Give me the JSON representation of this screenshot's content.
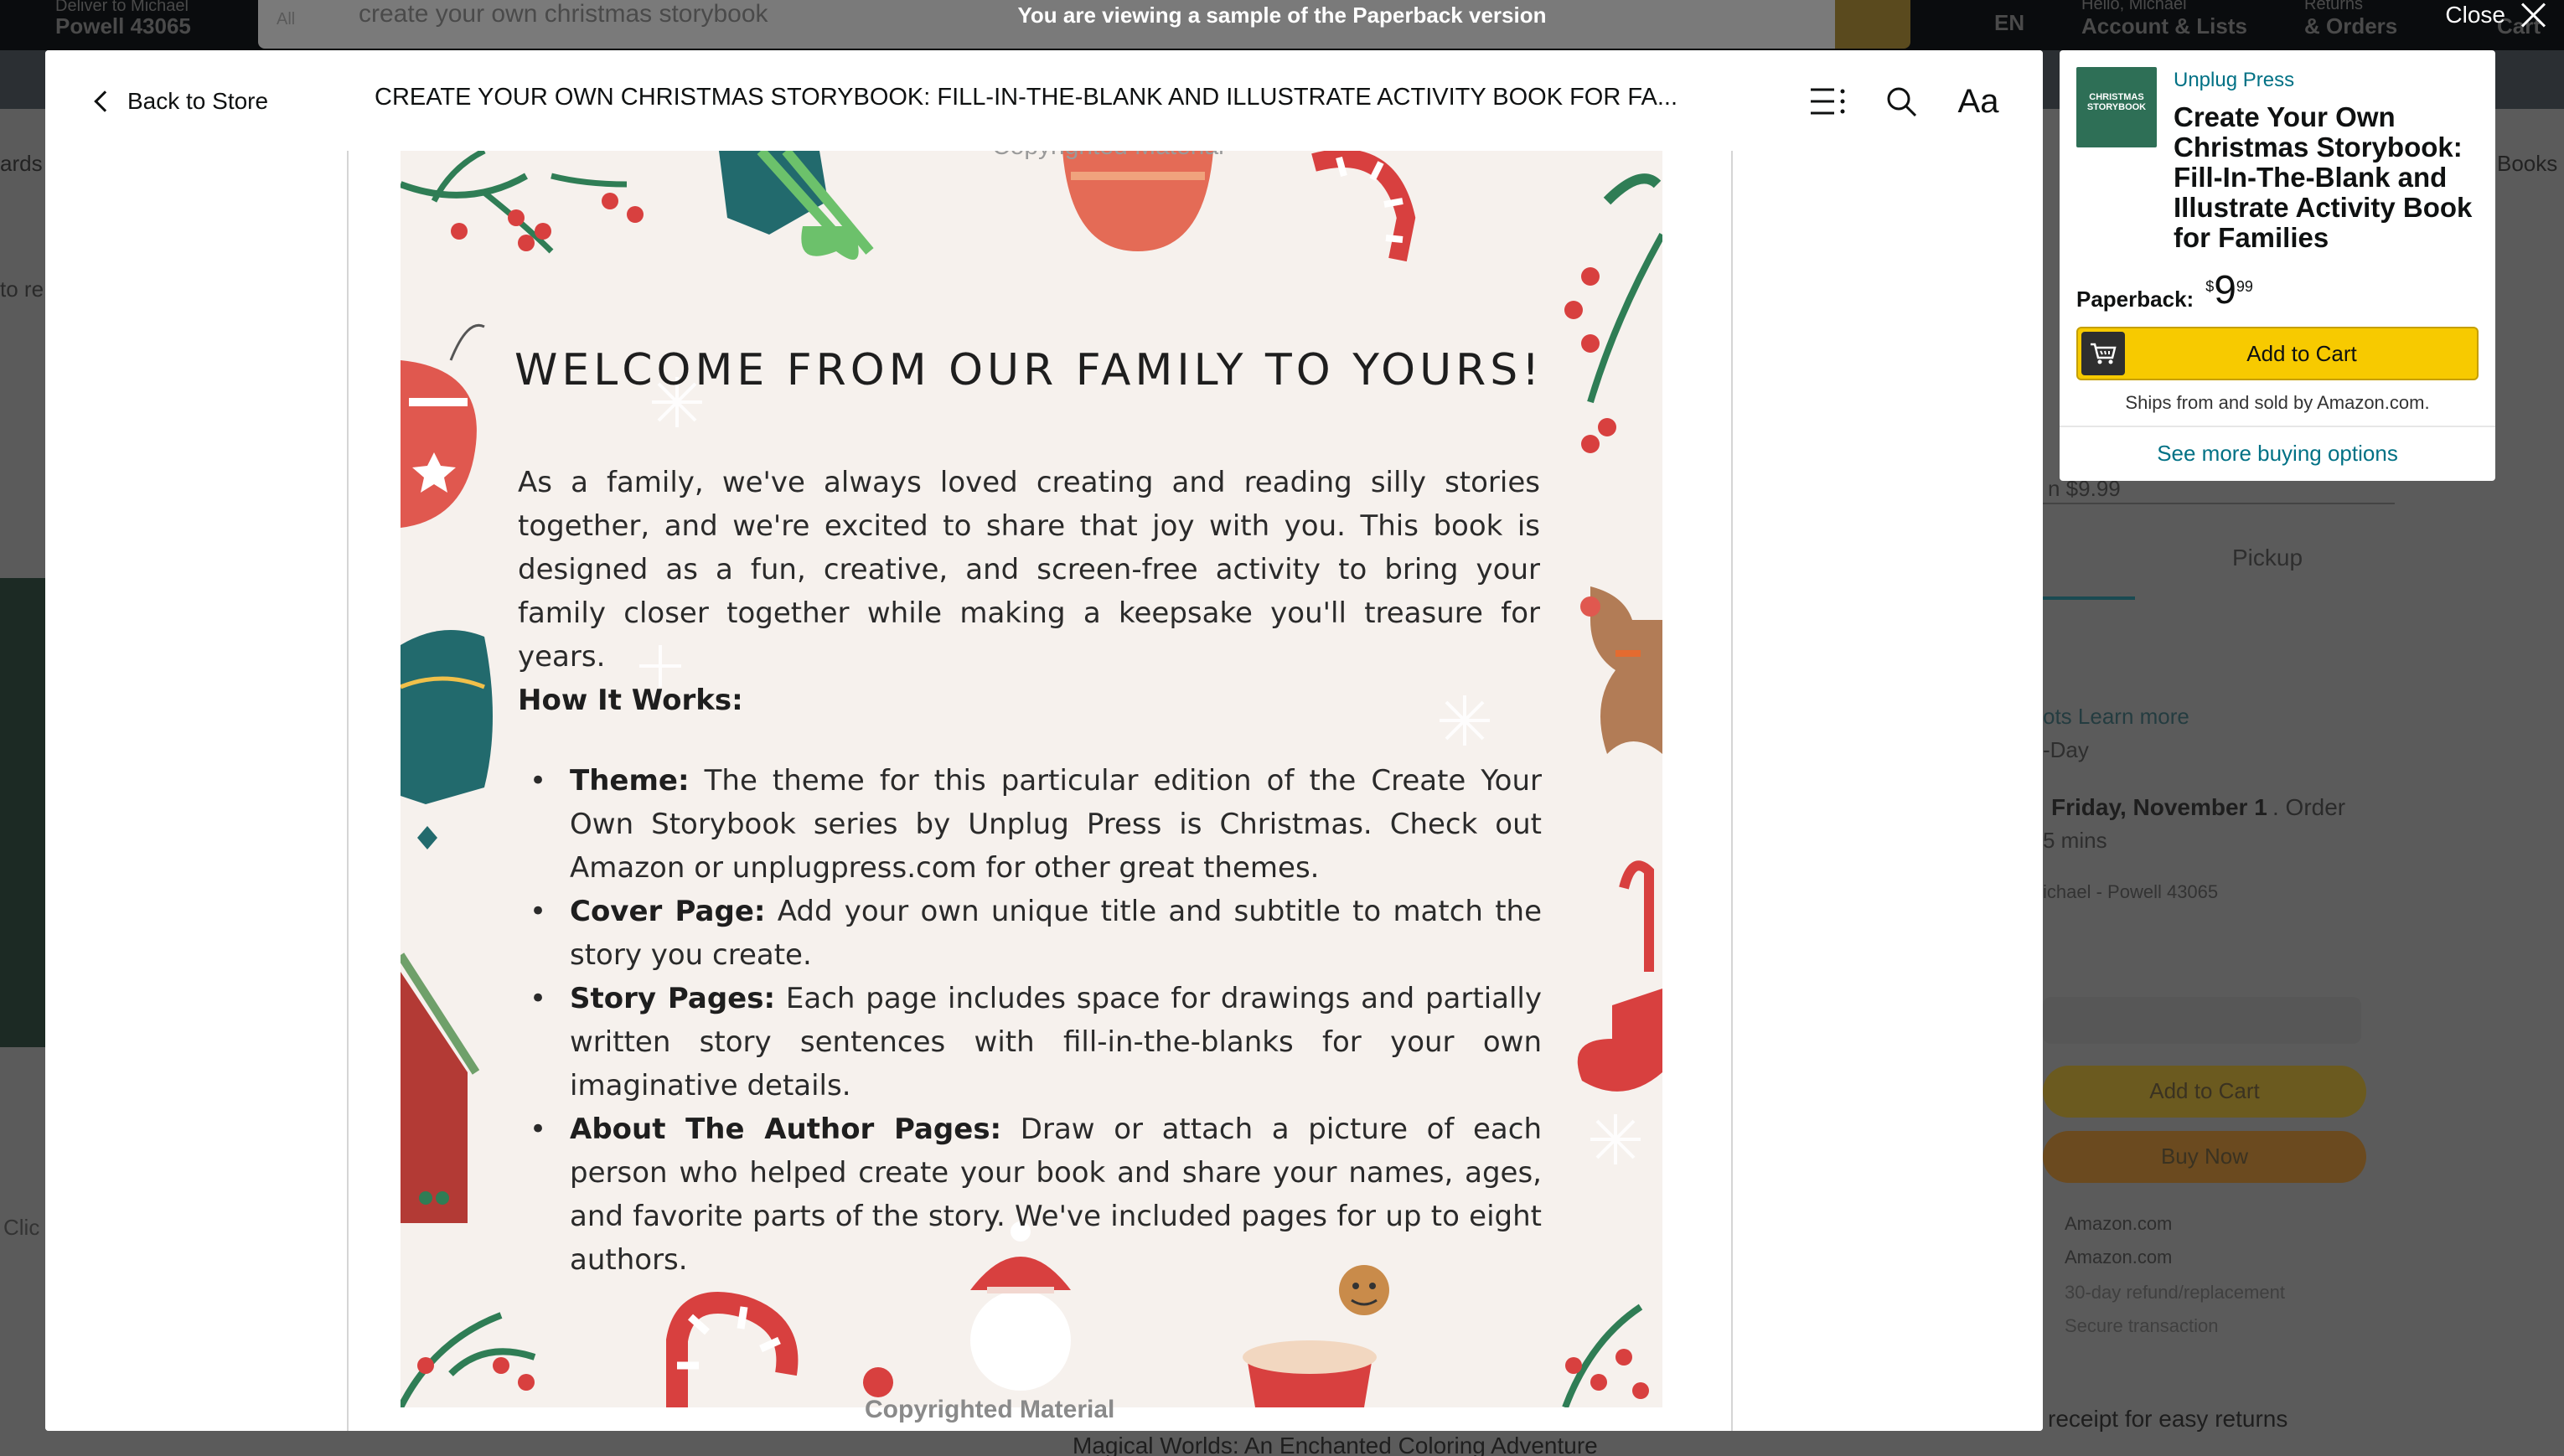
{
  "background": {
    "deliver_to": "Deliver to Michael",
    "location": "Powell 43065",
    "search_category": "All",
    "search_text": "create your own christmas storybook",
    "language": "EN",
    "greeting": "Hello, Michael",
    "account": "Account & Lists",
    "returns": "Returns",
    "orders": "& Orders",
    "cart": "Cart",
    "subnav_left": "ards",
    "subnav_right": "Books",
    "price_toggle": "n $9.99",
    "tab_pickup": "Pickup",
    "learn_more": "ots  Learn more",
    "delivery_day": "-Day",
    "delivery_date": "Friday, November 1",
    "delivery_order": ". Order",
    "delivery_mins": "5 mins",
    "deliver_address": "ichael - Powell 43065",
    "add_to_cart": "Add to Cart",
    "buy_now": "Buy Now",
    "ships_from": "Amazon.com",
    "sold_by": "Amazon.com",
    "returns_policy": "30-day refund/replacement",
    "payment": "Secure transaction",
    "gift_receipt": "receipt for easy returns",
    "related_title": "Magical Worlds: An Enchanted Coloring Adventure",
    "left_clip": "to re",
    "click_label": "Clic"
  },
  "banner": {
    "text": "You are viewing a sample of the Paperback version",
    "close_label": "Close"
  },
  "reader": {
    "back_label": "Back to Store",
    "title": "CREATE YOUR OWN CHRISTMAS STORYBOOK: FILL-IN-THE-BLANK AND ILLUSTRATE ACTIVITY BOOK FOR FA...",
    "font_button": "Aa",
    "page": {
      "copyright_top": "Copyrighted Material",
      "copyright_bottom": "Copyrighted Material",
      "heading": "WELCOME FROM OUR FAMILY TO YOURS!",
      "intro": "As a family, we've always loved creating and reading silly stories together, and we're excited to share that joy with you. This book is designed as a fun, creative, and screen-free activity to bring your family closer together while making a keepsake you'll treasure for years.",
      "how_title": "How It Works:",
      "bullets": [
        {
          "term": "Theme:",
          "text": "The theme for this particular edition of the Create Your Own Storybook series by Unplug Press is Christmas. Check out Amazon or unplugpress.com for other great themes."
        },
        {
          "term": "Cover Page:",
          "text": "Add your own unique title and subtitle to match the story you create."
        },
        {
          "term": "Story Pages:",
          "text": "Each page includes space for drawings and partially written story sentences with fill-in-the-blanks for your own imaginative details."
        },
        {
          "term": "About The Author Pages:",
          "text": "Draw or attach a picture of each person who helped create your book and share your names, ages, and favorite parts of the story. We've included pages for up to eight authors."
        }
      ]
    }
  },
  "buybox": {
    "cover_text": "CHRISTMAS STORYBOOK",
    "publisher": "Unplug Press",
    "title": "Create Your Own Christmas Storybook: Fill-In-The-Blank and Illustrate Activity Book for Families",
    "format_label": "Paperback:",
    "price_symbol": "$",
    "price_whole": "9",
    "price_fraction": "99",
    "add_to_cart": "Add to Cart",
    "ships_note": "Ships from and sold by Amazon.com.",
    "more_options": "See more buying options"
  },
  "colors": {
    "link": "#007185",
    "cart_button": "#f7ca00",
    "page_paper": "#f6f1ed",
    "holly_green": "#2f7d55",
    "berry_red": "#d8403f"
  },
  "icons": [
    "chevron-left-icon",
    "toc-icon",
    "search-icon",
    "font-size-icon",
    "close-icon",
    "cart-icon"
  ]
}
